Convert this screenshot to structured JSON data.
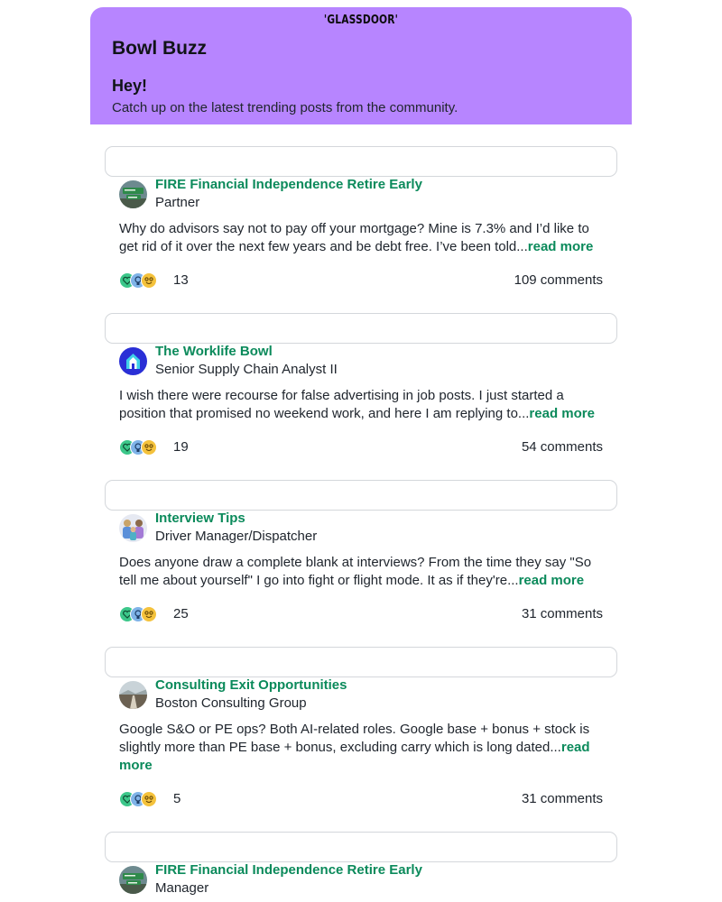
{
  "header": {
    "logo_text": "'GLASSDOOR'",
    "brand": "Bowl Buzz",
    "greeting": "Hey!",
    "subtitle": "Catch up on the latest trending posts from the community.",
    "bg_color": "#b785ff"
  },
  "read_more_label": "read more",
  "accent_color": "#0b8a5b",
  "posts": [
    {
      "bowl": "FIRE Financial Independence Retire Early",
      "role": "Partner",
      "text": "Why do advisors say not to pay off your mortgage? Mine is 7.3% and I’d like to get rid of it over the next few years and be debt free. I’ve been told...",
      "reactions": "13",
      "comments": "109 comments",
      "avatar_icon": "road-sign-avatar-icon"
    },
    {
      "bowl": "The Worklife Bowl",
      "role": "Senior Supply Chain Analyst II",
      "text": "I wish there were recourse for false advertising in job posts. I just started a position that promised no weekend work, and here I am replying to...",
      "reactions": "19",
      "comments": "54 comments",
      "avatar_icon": "house-avatar-icon"
    },
    {
      "bowl": "Interview Tips",
      "role": "Driver Manager/Dispatcher",
      "text": "Does anyone draw a complete blank at interviews? From the time they say \"So tell me about yourself\" I go into fight or flight mode. It as if they're...",
      "reactions": "25",
      "comments": "31 comments",
      "avatar_icon": "people-avatar-icon"
    },
    {
      "bowl": "Consulting Exit Opportunities",
      "role": "Boston Consulting Group",
      "text": "Google S&O or PE ops? Both AI-related roles. Google base + bonus + stock is slightly more than PE base + bonus, excluding carry which is long dated...",
      "reactions": "5",
      "comments": "31 comments",
      "avatar_icon": "landscape-avatar-icon"
    },
    {
      "bowl": "FIRE Financial Independence Retire Early",
      "role": "Manager",
      "avatar_icon": "road-sign-avatar-icon"
    }
  ]
}
